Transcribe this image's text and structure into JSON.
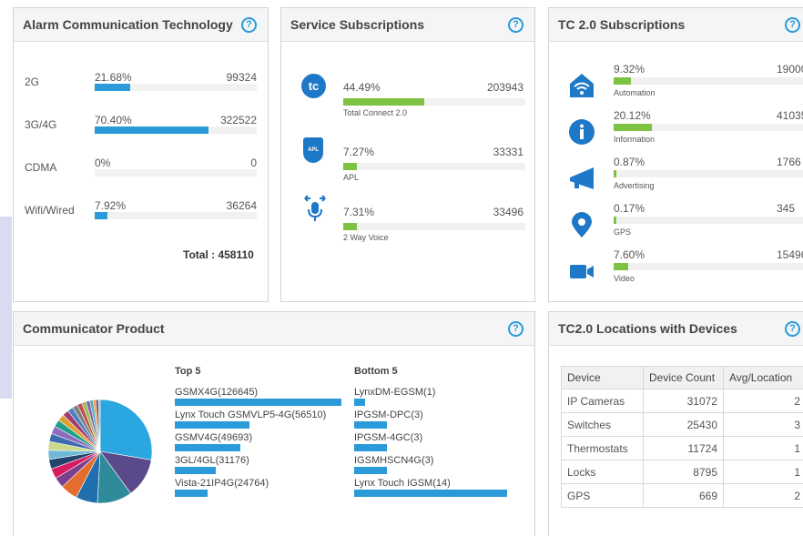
{
  "alarm": {
    "title": "Alarm Communication Technology",
    "rows": [
      {
        "label": "2G",
        "percent": "21.68%",
        "count": "99324",
        "fill": 0.2168
      },
      {
        "label": "3G/4G",
        "percent": "70.40%",
        "count": "322522",
        "fill": 0.704
      },
      {
        "label": "CDMA",
        "percent": "0%",
        "count": "0",
        "fill": 0
      },
      {
        "label": "Wifi/Wired",
        "percent": "7.92%",
        "count": "36264",
        "fill": 0.0792
      }
    ],
    "total": "Total : 458110"
  },
  "service": {
    "title": "Service Subscriptions",
    "rows": [
      {
        "icon": "tc",
        "icon_name": "total-connect-icon",
        "percent": "44.49%",
        "count": "203943",
        "label": "Total Connect 2.0",
        "fill": 0.4449
      },
      {
        "icon": "APL",
        "icon_name": "apl-shield-icon",
        "percent": "7.27%",
        "count": "33331",
        "label": "APL",
        "fill": 0.0727
      },
      {
        "icon": "",
        "icon_name": "microphone-voice-icon",
        "percent": "7.31%",
        "count": "33496",
        "label": "2 Way Voice",
        "fill": 0.0731
      }
    ]
  },
  "tc20": {
    "title": "TC 2.0 Subscriptions",
    "rows": [
      {
        "icon_name": "wifi-home-icon",
        "percent": "9.32%",
        "count": "19000",
        "label": "Automation",
        "fill": 0.0932
      },
      {
        "icon_name": "info-icon",
        "percent": "20.12%",
        "count": "41035",
        "label": "Information",
        "fill": 0.2012
      },
      {
        "icon_name": "megaphone-icon",
        "percent": "0.87%",
        "count": "1766",
        "label": "Advertising",
        "fill": 0.0087
      },
      {
        "icon_name": "map-pin-icon",
        "percent": "0.17%",
        "count": "345",
        "label": "GPS",
        "fill": 0.0017
      },
      {
        "icon_name": "video-camera-icon",
        "percent": "7.60%",
        "count": "15496",
        "label": "Video",
        "fill": 0.076
      }
    ]
  },
  "communicator": {
    "title": "Communicator Product",
    "top_label": "Top 5",
    "bottom_label": "Bottom 5",
    "top": [
      {
        "label": "GSMX4G(126645)",
        "value": 126645
      },
      {
        "label": "Lynx Touch GSMVLP5-4G(56510)",
        "value": 56510
      },
      {
        "label": "GSMV4G(49693)",
        "value": 49693
      },
      {
        "label": "3GL/4GL(31176)",
        "value": 31176
      },
      {
        "label": "Vista-21IP4G(24764)",
        "value": 24764
      }
    ],
    "bottom": [
      {
        "label": "LynxDM-EGSM(1)",
        "value": 1
      },
      {
        "label": "IPGSM-DPC(3)",
        "value": 3
      },
      {
        "label": "IPGSM-4GC(3)",
        "value": 3
      },
      {
        "label": "IGSMHSCN4G(3)",
        "value": 3
      },
      {
        "label": "Lynx Touch IGSM(14)",
        "value": 14
      }
    ],
    "pie_colors": [
      "#2aa7e0",
      "#5b4a8b",
      "#2f8a9a",
      "#1f6fae",
      "#e26d2c",
      "#7a3f8f",
      "#d81b60",
      "#24446e",
      "#6fb8d8",
      "#c9d88a",
      "#3d6bb0",
      "#8e6bbf",
      "#1f9e89",
      "#e0a030",
      "#a23b72",
      "#4f81bd",
      "#7f7f7f",
      "#c0504d",
      "#9bbb59",
      "#8064a2",
      "#4bacc6",
      "#f79646",
      "#2c4d75",
      "#d99694"
    ]
  },
  "locations": {
    "title": "TC2.0 Locations with Devices",
    "headers": [
      "Device",
      "Device Count",
      "Avg/Location"
    ],
    "rows": [
      [
        "IP Cameras",
        "31072",
        "2"
      ],
      [
        "Switches",
        "25430",
        "3"
      ],
      [
        "Thermostats",
        "11724",
        "1"
      ],
      [
        "Locks",
        "8795",
        "1"
      ],
      [
        "GPS",
        "669",
        "2"
      ]
    ]
  },
  "help_glyph": "?",
  "colors": {
    "accent_blue": "#2a9ad8",
    "accent_green": "#7dc242",
    "icon_blue": "#1e78c8"
  }
}
